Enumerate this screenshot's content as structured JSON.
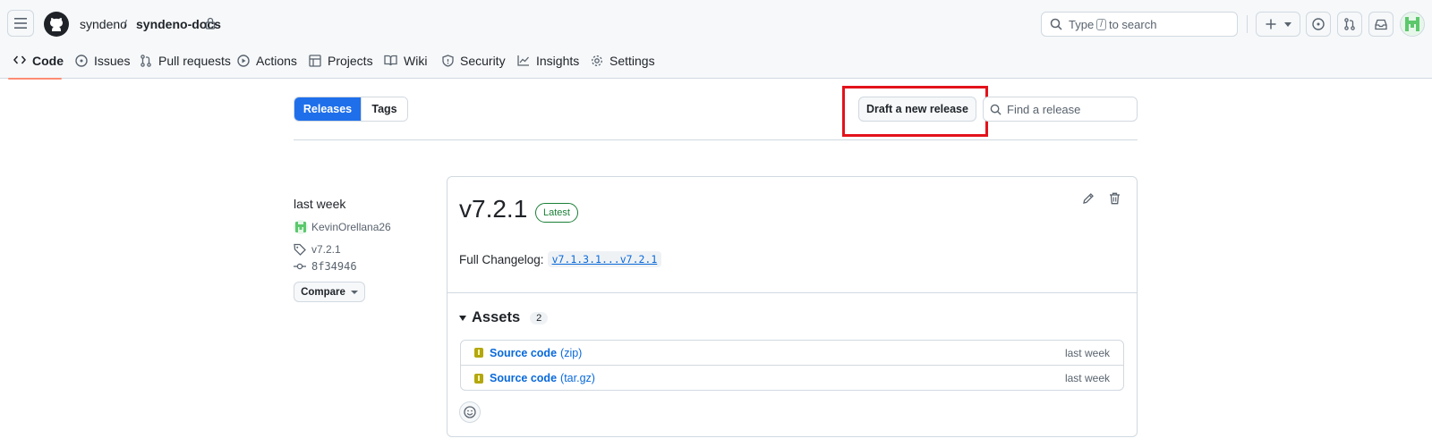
{
  "header": {
    "owner": "syndeno",
    "separator": "/",
    "repo": "syndeno-docs",
    "search_prefix": "Type",
    "search_key": "/",
    "search_suffix": "to search"
  },
  "nav_tabs": [
    {
      "label": "Code",
      "icon": "code-icon",
      "active": true
    },
    {
      "label": "Issues",
      "icon": "issue-icon"
    },
    {
      "label": "Pull requests",
      "icon": "pull-request-icon"
    },
    {
      "label": "Actions",
      "icon": "play-icon"
    },
    {
      "label": "Projects",
      "icon": "table-icon"
    },
    {
      "label": "Wiki",
      "icon": "book-icon"
    },
    {
      "label": "Security",
      "icon": "shield-icon"
    },
    {
      "label": "Insights",
      "icon": "graph-icon"
    },
    {
      "label": "Settings",
      "icon": "gear-icon"
    }
  ],
  "toolbar": {
    "releases_label": "Releases",
    "tags_label": "Tags",
    "draft_label": "Draft a new release",
    "find_placeholder": "Find a release"
  },
  "release": {
    "date": "last week",
    "author": "KevinOrellana26",
    "tag": "v7.2.1",
    "commit": "8f34946",
    "compare_label": "Compare",
    "title": "v7.2.1",
    "badge": "Latest",
    "changelog_label": "Full Changelog:",
    "changelog_link": "v7.1.3.1...v7.2.1",
    "assets_label": "Assets",
    "assets_count": "2",
    "assets": [
      {
        "name": "Source code",
        "ext": "(zip)",
        "date": "last week"
      },
      {
        "name": "Source code",
        "ext": "(tar.gz)",
        "date": "last week"
      }
    ]
  },
  "colors": {
    "primary": "#1f6feb",
    "latest_badge": "#1a7f37",
    "highlight": "#e3121b",
    "tab_underline": "#fd8c73"
  }
}
